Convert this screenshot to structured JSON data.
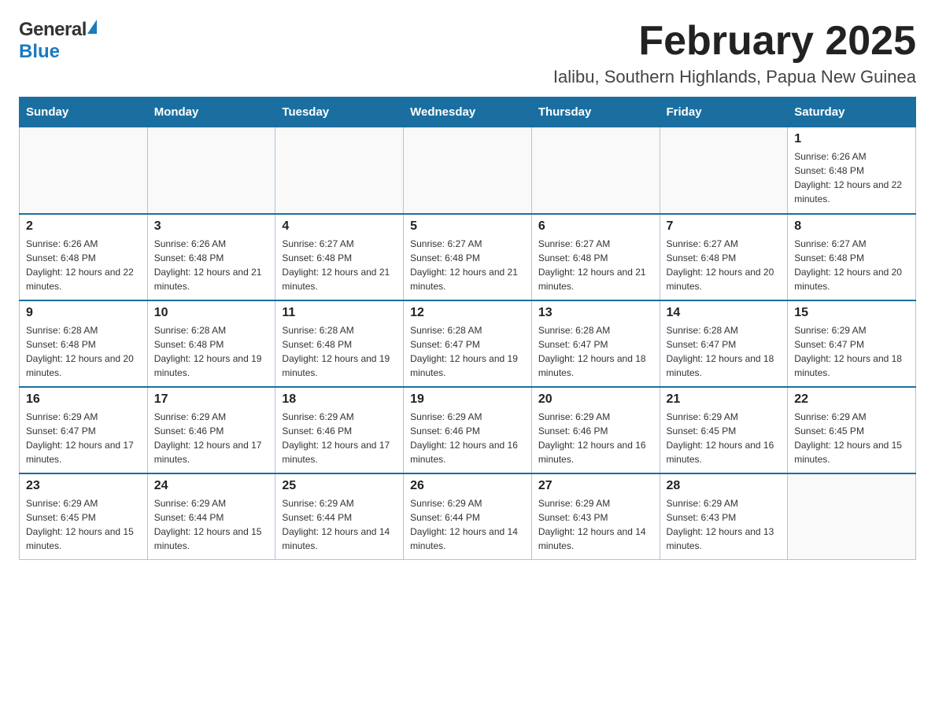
{
  "logo": {
    "general": "General",
    "blue": "Blue",
    "arrow": "▲"
  },
  "header": {
    "month": "February 2025",
    "location": "Ialibu, Southern Highlands, Papua New Guinea"
  },
  "days": {
    "headers": [
      "Sunday",
      "Monday",
      "Tuesday",
      "Wednesday",
      "Thursday",
      "Friday",
      "Saturday"
    ]
  },
  "weeks": [
    {
      "cells": [
        {
          "date": "",
          "info": ""
        },
        {
          "date": "",
          "info": ""
        },
        {
          "date": "",
          "info": ""
        },
        {
          "date": "",
          "info": ""
        },
        {
          "date": "",
          "info": ""
        },
        {
          "date": "",
          "info": ""
        },
        {
          "date": "1",
          "info": "Sunrise: 6:26 AM\nSunset: 6:48 PM\nDaylight: 12 hours and 22 minutes."
        }
      ]
    },
    {
      "cells": [
        {
          "date": "2",
          "info": "Sunrise: 6:26 AM\nSunset: 6:48 PM\nDaylight: 12 hours and 22 minutes."
        },
        {
          "date": "3",
          "info": "Sunrise: 6:26 AM\nSunset: 6:48 PM\nDaylight: 12 hours and 21 minutes."
        },
        {
          "date": "4",
          "info": "Sunrise: 6:27 AM\nSunset: 6:48 PM\nDaylight: 12 hours and 21 minutes."
        },
        {
          "date": "5",
          "info": "Sunrise: 6:27 AM\nSunset: 6:48 PM\nDaylight: 12 hours and 21 minutes."
        },
        {
          "date": "6",
          "info": "Sunrise: 6:27 AM\nSunset: 6:48 PM\nDaylight: 12 hours and 21 minutes."
        },
        {
          "date": "7",
          "info": "Sunrise: 6:27 AM\nSunset: 6:48 PM\nDaylight: 12 hours and 20 minutes."
        },
        {
          "date": "8",
          "info": "Sunrise: 6:27 AM\nSunset: 6:48 PM\nDaylight: 12 hours and 20 minutes."
        }
      ]
    },
    {
      "cells": [
        {
          "date": "9",
          "info": "Sunrise: 6:28 AM\nSunset: 6:48 PM\nDaylight: 12 hours and 20 minutes."
        },
        {
          "date": "10",
          "info": "Sunrise: 6:28 AM\nSunset: 6:48 PM\nDaylight: 12 hours and 19 minutes."
        },
        {
          "date": "11",
          "info": "Sunrise: 6:28 AM\nSunset: 6:48 PM\nDaylight: 12 hours and 19 minutes."
        },
        {
          "date": "12",
          "info": "Sunrise: 6:28 AM\nSunset: 6:47 PM\nDaylight: 12 hours and 19 minutes."
        },
        {
          "date": "13",
          "info": "Sunrise: 6:28 AM\nSunset: 6:47 PM\nDaylight: 12 hours and 18 minutes."
        },
        {
          "date": "14",
          "info": "Sunrise: 6:28 AM\nSunset: 6:47 PM\nDaylight: 12 hours and 18 minutes."
        },
        {
          "date": "15",
          "info": "Sunrise: 6:29 AM\nSunset: 6:47 PM\nDaylight: 12 hours and 18 minutes."
        }
      ]
    },
    {
      "cells": [
        {
          "date": "16",
          "info": "Sunrise: 6:29 AM\nSunset: 6:47 PM\nDaylight: 12 hours and 17 minutes."
        },
        {
          "date": "17",
          "info": "Sunrise: 6:29 AM\nSunset: 6:46 PM\nDaylight: 12 hours and 17 minutes."
        },
        {
          "date": "18",
          "info": "Sunrise: 6:29 AM\nSunset: 6:46 PM\nDaylight: 12 hours and 17 minutes."
        },
        {
          "date": "19",
          "info": "Sunrise: 6:29 AM\nSunset: 6:46 PM\nDaylight: 12 hours and 16 minutes."
        },
        {
          "date": "20",
          "info": "Sunrise: 6:29 AM\nSunset: 6:46 PM\nDaylight: 12 hours and 16 minutes."
        },
        {
          "date": "21",
          "info": "Sunrise: 6:29 AM\nSunset: 6:45 PM\nDaylight: 12 hours and 16 minutes."
        },
        {
          "date": "22",
          "info": "Sunrise: 6:29 AM\nSunset: 6:45 PM\nDaylight: 12 hours and 15 minutes."
        }
      ]
    },
    {
      "cells": [
        {
          "date": "23",
          "info": "Sunrise: 6:29 AM\nSunset: 6:45 PM\nDaylight: 12 hours and 15 minutes."
        },
        {
          "date": "24",
          "info": "Sunrise: 6:29 AM\nSunset: 6:44 PM\nDaylight: 12 hours and 15 minutes."
        },
        {
          "date": "25",
          "info": "Sunrise: 6:29 AM\nSunset: 6:44 PM\nDaylight: 12 hours and 14 minutes."
        },
        {
          "date": "26",
          "info": "Sunrise: 6:29 AM\nSunset: 6:44 PM\nDaylight: 12 hours and 14 minutes."
        },
        {
          "date": "27",
          "info": "Sunrise: 6:29 AM\nSunset: 6:43 PM\nDaylight: 12 hours and 14 minutes."
        },
        {
          "date": "28",
          "info": "Sunrise: 6:29 AM\nSunset: 6:43 PM\nDaylight: 12 hours and 13 minutes."
        },
        {
          "date": "",
          "info": ""
        }
      ]
    }
  ]
}
